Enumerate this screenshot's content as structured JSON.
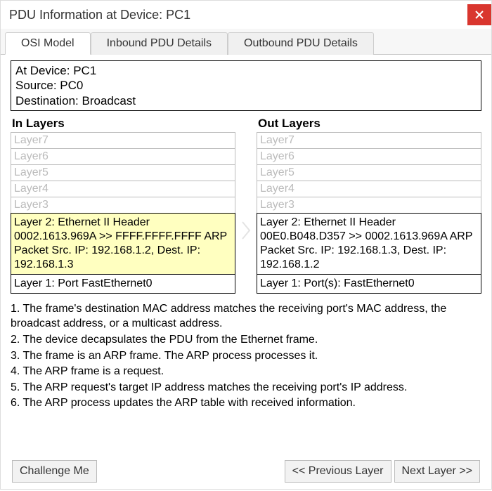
{
  "titlebar": {
    "title": "PDU Information at Device: PC1"
  },
  "tabs": [
    {
      "label": "OSI Model",
      "active": true
    },
    {
      "label": "Inbound PDU Details",
      "active": false
    },
    {
      "label": "Outbound PDU Details",
      "active": false
    }
  ],
  "info": {
    "at_device_label": "At Device: PC1",
    "source_label": "Source: PC0",
    "destination_label": "Destination: Broadcast"
  },
  "in_layers": {
    "title": "In Layers",
    "layers": [
      {
        "label": "Layer7",
        "active": false
      },
      {
        "label": "Layer6",
        "active": false
      },
      {
        "label": "Layer5",
        "active": false
      },
      {
        "label": "Layer4",
        "active": false
      },
      {
        "label": "Layer3",
        "active": false
      },
      {
        "label": "Layer 2: Ethernet II Header 0002.1613.969A >> FFFF.FFFF.FFFF ARP Packet Src. IP: 192.168.1.2, Dest. IP: 192.168.1.3",
        "active": true,
        "highlight": true
      },
      {
        "label": "Layer 1: Port FastEthernet0",
        "active": true
      }
    ]
  },
  "out_layers": {
    "title": "Out Layers",
    "layers": [
      {
        "label": "Layer7",
        "active": false
      },
      {
        "label": "Layer6",
        "active": false
      },
      {
        "label": "Layer5",
        "active": false
      },
      {
        "label": "Layer4",
        "active": false
      },
      {
        "label": "Layer3",
        "active": false
      },
      {
        "label": "Layer 2: Ethernet II Header 00E0.B048.D357 >> 0002.1613.969A ARP Packet Src. IP: 192.168.1.3, Dest. IP: 192.168.1.2",
        "active": true
      },
      {
        "label": "Layer 1: Port(s): FastEthernet0",
        "active": true
      }
    ]
  },
  "steps": [
    "1. The frame's destination MAC address matches the receiving port's MAC address, the broadcast address, or a multicast address.",
    "2. The device decapsulates the PDU from the Ethernet frame.",
    "3. The frame is an ARP frame. The ARP process processes it.",
    "4. The ARP frame is a request.",
    "5. The ARP request's target IP address matches the receiving port's IP address.",
    "6. The ARP process updates the ARP table with received information."
  ],
  "footer": {
    "challenge": "Challenge Me",
    "prev": "<< Previous Layer",
    "next": "Next Layer >>"
  }
}
